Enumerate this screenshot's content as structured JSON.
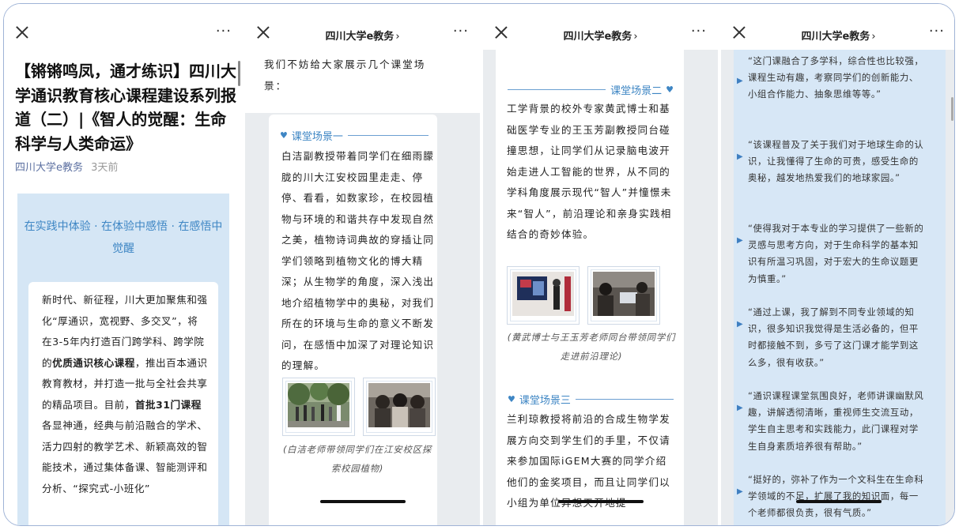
{
  "screen1": {
    "title": "【锵锵鸣凤，通才练识】四川大学通识教育核心课程建设系列报道（二）|《智人的觉醒：生命科学与人类命运》",
    "author": "四川大学e教务",
    "time": "3天前",
    "slogan": "在实践中体验 · 在体验中感悟 · 在感悟中觉醒",
    "intro_a": "新时代、新征程，川大更加聚焦和强化“厚通识，宽视野、多交叉”，将在3-5年内打造百门跨学科、跨学院的",
    "intro_b": "优质通识核心课程",
    "intro_c": "，推出百本通识教育教材，并打造一批与全社会共享的精品项目。目前，",
    "intro_d": "首批31门课程",
    "intro_e": "各显神通，经典与前沿融合的学术、活力四射的教学艺术、新颖高效的智能技术，通过集体备课、智能测评和分析、“探究式-小班化”"
  },
  "nav": {
    "title": "四川大学e教务",
    "chevron": "›",
    "more": "···"
  },
  "screen2": {
    "intro": "我们不妨给大家展示几个课堂场景：",
    "scene1_title": "课堂场景一",
    "scene1_text": "白洁副教授带着同学们在细雨朦胧的川大江安校园里走走、停停、看看，如数家珍，在校园植物与环境的和谐共存中发现自然之美，植物诗词典故的穿插让同学们领略到植物文化的博大精深；从生物学的角度，深入浅出地介绍植物学中的奥秘，对我们所在的环境与生命的意义不断发问，在感悟中加深了对理论知识的理解。",
    "caption": "(白洁老师带领同学们在江安校区探索校园植物)"
  },
  "screen3": {
    "scene2_title": "课堂场景二",
    "scene2_text": "工学背景的校外专家黄武博士和基础医学专业的王玉芳副教授同台碰撞思想，让同学们从记录脑电波开始走进人工智能的世界，从不同的学科角度展示现代“智人”并憧憬未来“智人”，前沿理论和亲身实践相结合的奇妙体验。",
    "caption": "(黄武博士与王玉芳老师同台带领同学们走进前沿理论)",
    "scene3_title": "课堂场景三",
    "scene3_text": "兰利琼教授将前沿的合成生物学发展方向交到学生们的手里，不仅请来参加国际iGEM大赛的同学介绍他们的金奖项目，而且让同学们以小组为单位异想天开地提"
  },
  "screen4": {
    "quotes": [
      "“这门课融合了多学科，综合性也比较强，课程生动有趣，考察同学们的创新能力、小组合作能力、抽象思维等等。”",
      "“该课程普及了关于我们对于地球生命的认识，让我懂得了生命的可贵，感受生命的奥秘，越发地热爱我们的地球家园。”",
      "“使得我对于本专业的学习提供了一些新的灵感与思考方向，对于生命科学的基本知识有所温习巩固，对于宏大的生命议题更为慎重。”",
      "“通过上课，我了解到不同专业领域的知识，很多知识我觉得是生活必备的，但平时都接触不到，多亏了这门课才能学到这么多，很有收获。”",
      "“通识课程课堂氛围良好，老师讲课幽默风趣，讲解透彻清晰，重视师生交流互动，学生自主思考和实践能力，此门课程对学生自身素质培养很有帮助。”",
      "“挺好的，弥补了作为一个文科生在生命科学领域的不足，扩展了我的知识面，每一个老师都很负责，很有气质。”"
    ]
  },
  "icons": {
    "close": "close-icon",
    "more": "more-icon",
    "heart": "heart-icon",
    "triangle": "play-triangle-icon"
  },
  "colors": {
    "accent_blue": "#3e86c4",
    "panel_blue": "#d5e6f5",
    "author_blue": "#5b6fa0"
  }
}
